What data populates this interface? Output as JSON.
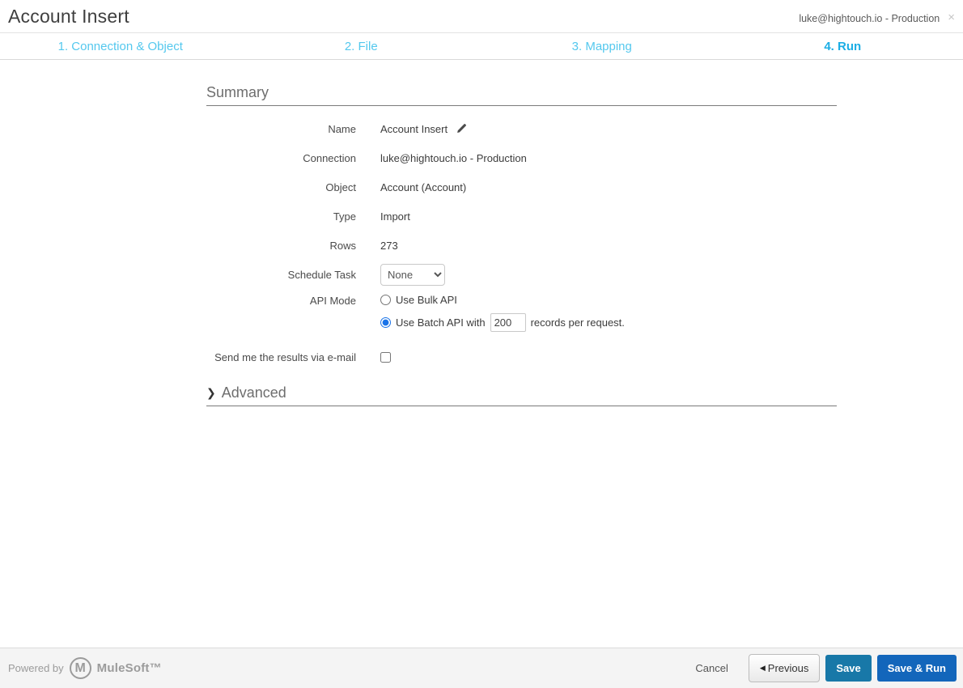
{
  "colors": {
    "tab-inactive": "#54c8ee",
    "tab-active": "#1caee5",
    "save-bg": "#1878a8",
    "save-run-bg": "#1366bb",
    "radio-accent": "#1a73e8"
  },
  "header": {
    "title": "Account Insert",
    "connection": "luke@hightouch.io - Production",
    "close_glyph": "×"
  },
  "steps": [
    {
      "label": "1. Connection & Object"
    },
    {
      "label": "2. File"
    },
    {
      "label": "3. Mapping"
    },
    {
      "label": "4. Run"
    }
  ],
  "summary": {
    "heading": "Summary",
    "name": {
      "label": "Name",
      "value": "Account Insert"
    },
    "connection": {
      "label": "Connection",
      "value": "luke@hightouch.io - Production"
    },
    "object": {
      "label": "Object",
      "value": "Account (Account)"
    },
    "type": {
      "label": "Type",
      "value": "Import"
    },
    "rows": {
      "label": "Rows",
      "value": "273"
    },
    "schedule": {
      "label": "Schedule Task",
      "selected": "None"
    },
    "api_mode": {
      "label": "API Mode",
      "bulk_option": "Use Bulk API",
      "batch_option_prefix": "Use Batch API with",
      "batch_size": "200",
      "batch_option_suffix": "records per request."
    },
    "email": {
      "label": "Send me the results via e-mail"
    }
  },
  "advanced": {
    "heading": "Advanced",
    "chevron_glyph": "❯"
  },
  "footer": {
    "powered_by": "Powered by",
    "logo_letter": "M",
    "brand": "MuleSoft™",
    "cancel_label": "Cancel",
    "previous_glyph": "◀",
    "previous_label": "Previous",
    "save_label": "Save",
    "save_run_label": "Save & Run"
  }
}
